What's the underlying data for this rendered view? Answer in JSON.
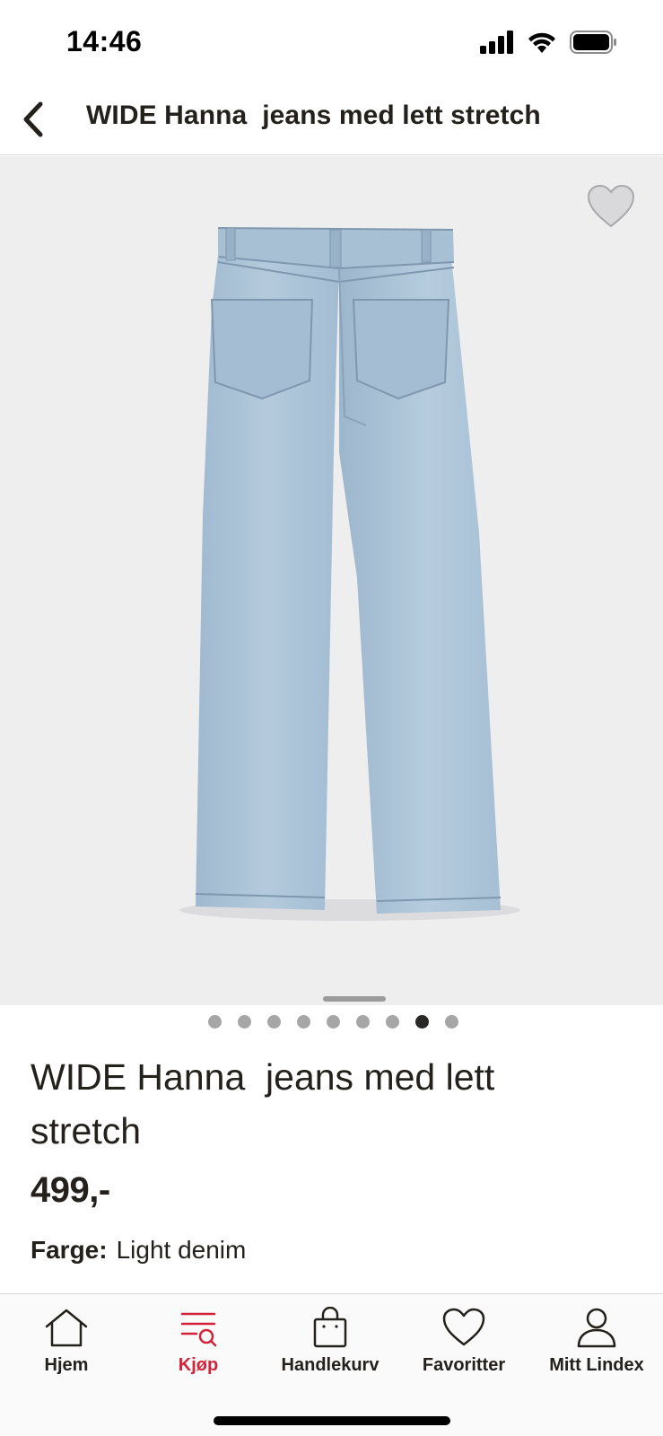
{
  "status_bar": {
    "time": "14:46"
  },
  "header": {
    "title": "WIDE Hanna  jeans med lett stretch",
    "back_icon": "chevron-left-icon"
  },
  "gallery": {
    "image_subject": "light-denim-jeans-back-view",
    "favorite_icon": "heart-outline-icon",
    "total_images": 9,
    "active_index": 7
  },
  "product": {
    "name": "WIDE Hanna  jeans med lett stretch",
    "price": "499,-",
    "color_label": "Farge:",
    "color_value": "Light denim"
  },
  "tab_bar": {
    "items": [
      {
        "label": "Hjem",
        "icon": "home-icon",
        "active": false
      },
      {
        "label": "Kjøp",
        "icon": "shop-search-icon",
        "active": true
      },
      {
        "label": "Handlekurv",
        "icon": "shopping-bag-icon",
        "active": false
      },
      {
        "label": "Favoritter",
        "icon": "heart-icon",
        "active": false
      },
      {
        "label": "Mitt Lindex",
        "icon": "user-icon",
        "active": false
      }
    ]
  },
  "colors": {
    "accent": "#d3233a",
    "text": "#24211d",
    "image_bg": "#eeeeef",
    "denim": "#a9c3d8"
  }
}
